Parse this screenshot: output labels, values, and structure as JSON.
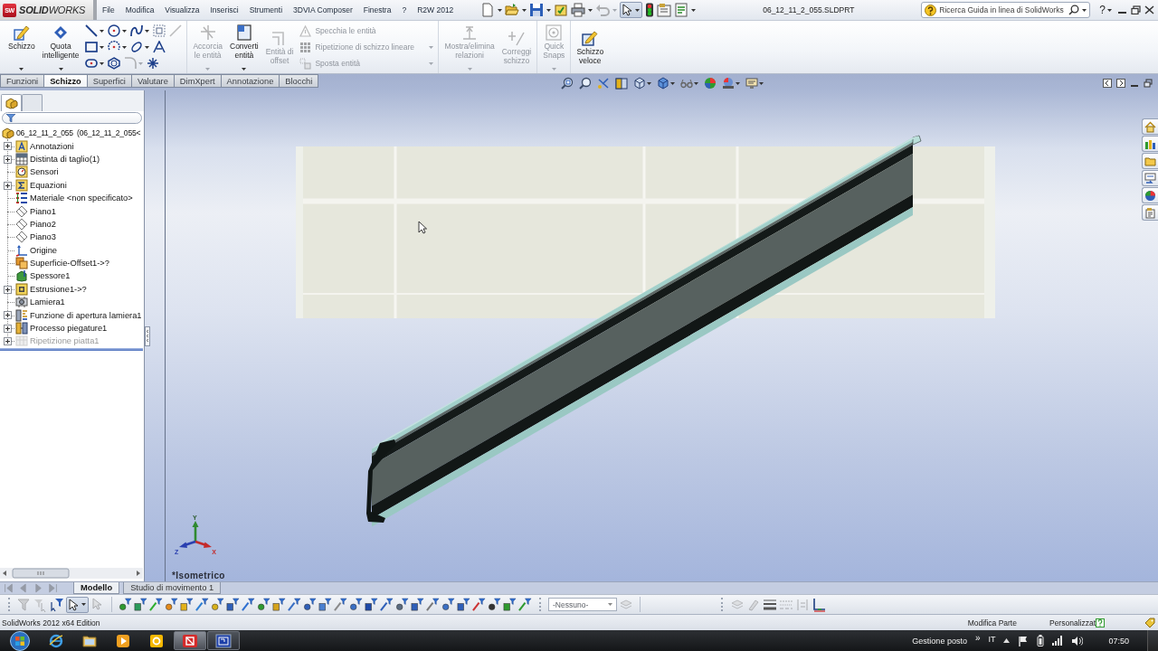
{
  "app": {
    "logo_mark": "SW",
    "logo_text": "**SOLID**WORKS"
  },
  "menu": [
    "File",
    "Modifica",
    "Visualizza",
    "Inserisci",
    "Strumenti",
    "3DVIA Composer",
    "Finestra",
    "?",
    "R2W 2012"
  ],
  "window": {
    "title": "06_12_11_2_055.SLDPRT",
    "help_glyph": "?"
  },
  "search": {
    "placeholder": "Ricerca Guida in linea di SolidWorks"
  },
  "ribbon": [
    {
      "items": [
        {
          "kind": "large",
          "label": "Schizzo",
          "disabled": false,
          "dropdown": true
        },
        {
          "kind": "large",
          "label": "Quota\nintelligente",
          "disabled": false,
          "dropdown": true
        },
        {
          "kind": "tools",
          "rows": [
            [
              {
                "dropdown": true,
                "disabled": false
              },
              {
                "dropdown": true,
                "disabled": false
              },
              {
                "dropdown": true,
                "disabled": false
              },
              {
                "dropdown": false,
                "disabled": false
              },
              {
                "dropdown": false,
                "disabled": true
              }
            ],
            [
              {
                "dropdown": true,
                "disabled": false
              },
              {
                "dropdown": true,
                "disabled": false
              },
              {
                "dropdown": true,
                "disabled": false
              },
              {
                "dropdown": false,
                "disabled": false
              }
            ],
            [
              {
                "dropdown": true,
                "disabled": false
              },
              {
                "dropdown": false,
                "disabled": false
              },
              {
                "dropdown": true,
                "disabled": true
              },
              {
                "dropdown": false,
                "disabled": false
              }
            ]
          ]
        }
      ]
    },
    {
      "items": [
        {
          "kind": "large",
          "label": "Accorcia\nle entità",
          "disabled": true,
          "dropdown": true
        },
        {
          "kind": "large",
          "label": "Converti\nentità",
          "disabled": false,
          "dropdown": true
        },
        {
          "kind": "large",
          "label": "Entità di\noffset",
          "disabled": true,
          "dropdown": false
        },
        {
          "kind": "stack",
          "items": [
            {
              "label": "Specchia le entità",
              "disabled": true,
              "dropdown": false
            },
            {
              "label": "Ripetizione di schizzo lineare",
              "disabled": true,
              "dropdown": true
            },
            {
              "label": "Sposta entità",
              "disabled": true,
              "dropdown": true
            }
          ]
        }
      ]
    },
    {
      "items": [
        {
          "kind": "large",
          "label": "Mostra/elimina\nrelazioni",
          "disabled": true,
          "dropdown": true
        },
        {
          "kind": "large",
          "label": "Correggi\nschizzo",
          "disabled": true,
          "dropdown": false
        }
      ]
    },
    {
      "items": [
        {
          "kind": "large",
          "label": "Quick\nSnaps",
          "disabled": true,
          "dropdown": true
        }
      ]
    },
    {
      "items": [
        {
          "kind": "large",
          "label": "Schizzo\nveloce",
          "disabled": false,
          "dropdown": false
        }
      ]
    }
  ],
  "command_tabs": [
    {
      "label": "Funzioni",
      "selected": false
    },
    {
      "label": "Schizzo",
      "selected": true
    },
    {
      "label": "Superfici",
      "selected": false
    },
    {
      "label": "Valutare",
      "selected": false
    },
    {
      "label": "DimXpert",
      "selected": false
    },
    {
      "label": "Annotazione",
      "selected": false
    },
    {
      "label": "Blocchi",
      "selected": false
    }
  ],
  "feature_tree": {
    "tabs": [
      {
        "selected": true
      },
      {
        "selected": false
      }
    ],
    "root": {
      "label": "06_12_11_2_055  (06_12_11_2_055<",
      "children": [
        {
          "label": "Annotazioni",
          "kind": "annotations",
          "expandable": true,
          "suppressed": false
        },
        {
          "label": "Distinta di taglio(1)",
          "kind": "cut-list",
          "expandable": true,
          "suppressed": false
        },
        {
          "label": "Sensori",
          "kind": "sensors",
          "expandable": false,
          "suppressed": false
        },
        {
          "label": "Equazioni",
          "kind": "equations",
          "expandable": true,
          "suppressed": false
        },
        {
          "label": "Materiale <non specificato>",
          "kind": "material",
          "expandable": false,
          "suppressed": false
        },
        {
          "label": "Piano1",
          "kind": "plane",
          "expandable": false,
          "suppressed": false
        },
        {
          "label": "Piano2",
          "kind": "plane",
          "expandable": false,
          "suppressed": false
        },
        {
          "label": "Piano3",
          "kind": "plane",
          "expandable": false,
          "suppressed": false
        },
        {
          "label": "Origine",
          "kind": "origin",
          "expandable": false,
          "suppressed": false
        },
        {
          "label": "Superficie-Offset1->?",
          "kind": "surface",
          "expandable": false,
          "suppressed": false
        },
        {
          "label": "Spessore1",
          "kind": "thicken",
          "expandable": false,
          "suppressed": false
        },
        {
          "label": "Estrusione1->?",
          "kind": "extrude",
          "expandable": true,
          "suppressed": false
        },
        {
          "label": "Lamiera1",
          "kind": "sheet-metal",
          "expandable": false,
          "suppressed": false
        },
        {
          "label": "Funzione di apertura lamiera1",
          "kind": "flatten",
          "expandable": true,
          "suppressed": false
        },
        {
          "label": "Processo piegature1",
          "kind": "bend",
          "expandable": true,
          "suppressed": false
        },
        {
          "label": "Ripetizione piatta1",
          "kind": "flat-pattern",
          "expandable": true,
          "suppressed": true
        }
      ]
    }
  },
  "viewport": {
    "view_label": "*Isometrico",
    "triad": {
      "y": "Y",
      "z": "Z",
      "x": "X"
    }
  },
  "bottom_tabs": [
    {
      "label": "Modello",
      "selected": true
    },
    {
      "label": "Studio di movimento 1",
      "selected": false
    }
  ],
  "filter_toolbar": {
    "layer_select": {
      "value": "-Nessuno-"
    }
  },
  "status_bar": {
    "product": "SolidWorks 2012 x64 Edition",
    "mode": "Modifica Parte",
    "units": "Personalizzat"
  },
  "taskbar": {
    "apps": [
      {
        "kind": "browser",
        "running": false,
        "selected": false
      },
      {
        "kind": "folder",
        "running": false,
        "selected": false
      },
      {
        "kind": "media",
        "running": false,
        "selected": false
      },
      {
        "kind": "mail",
        "running": false,
        "selected": false
      },
      {
        "kind": "cad",
        "running": true,
        "selected": true
      },
      {
        "kind": "window",
        "running": true,
        "selected": false
      }
    ],
    "tray_label": "Gestione posto",
    "chevron": "»",
    "language": "IT",
    "clock": "07:50"
  }
}
